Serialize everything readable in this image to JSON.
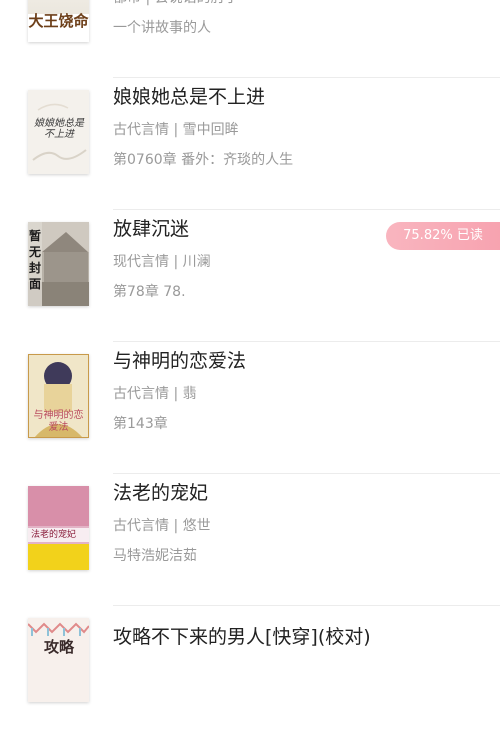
{
  "books": [
    {
      "title": "",
      "meta": "都市 | 会说话的肘子",
      "chapter": "一个讲故事的人",
      "cover_text": "大王饶命"
    },
    {
      "title": "娘娘她总是不上进",
      "meta": "古代言情 | 雪中回眸",
      "chapter": "第0760章 番外：齐琰的人生",
      "cover_text": "娘娘她总是不上进"
    },
    {
      "title": "放肆沉迷",
      "meta": "现代言情 | 川澜",
      "chapter": "第78章 78.",
      "cover_text": "暂无封面",
      "progress_badge": "75.82% 已读",
      "progress_percent": 75.82
    },
    {
      "title": "与神明的恋爱法",
      "meta": "古代言情 | 翡",
      "chapter": "第143章",
      "cover_text": "与神明的恋爱法"
    },
    {
      "title": "法老的宠妃",
      "meta": "古代言情 | 悠世",
      "chapter": "马特浩妮洁茹",
      "cover_text": "法老的宠妃"
    },
    {
      "title": "攻略不下来的男人[快穿](校对)",
      "meta": "",
      "chapter": "",
      "cover_text": "攻略"
    }
  ],
  "colors": {
    "title": "#222222",
    "secondary": "#9a9a9a",
    "badge": "#f7a3b0",
    "divider": "#ececec"
  }
}
